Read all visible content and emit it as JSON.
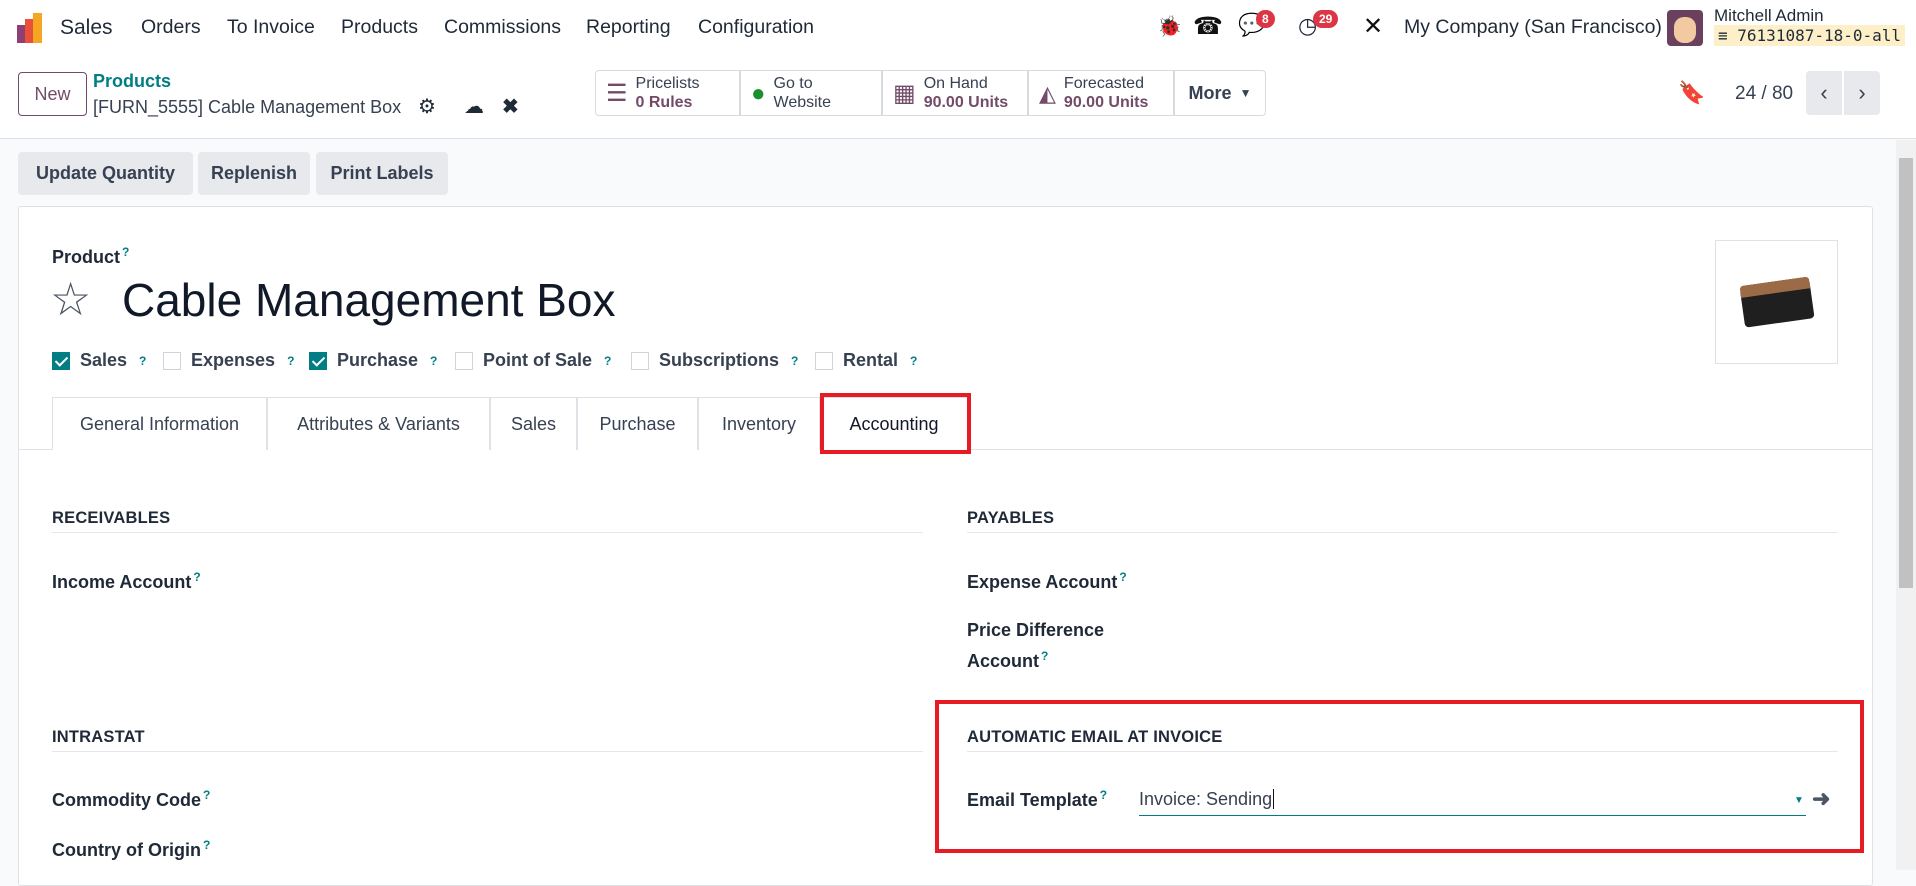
{
  "nav": {
    "app": "Sales",
    "menu": [
      "Orders",
      "To Invoice",
      "Products",
      "Commissions",
      "Reporting",
      "Configuration"
    ],
    "messages_count": "8",
    "activities_count": "29",
    "company": "My Company (San Francisco)",
    "user": "Mitchell Admin",
    "db": "76131087-18-0-all"
  },
  "control": {
    "new_label": "New",
    "breadcrumb_parent": "Products",
    "record_name": "[FURN_5555] Cable Management Box",
    "pager": "24 / 80",
    "more_label": "More",
    "stats": [
      {
        "line1": "Pricelists",
        "line2": "0 Rules"
      },
      {
        "line1": "Go to",
        "line2": "Website"
      },
      {
        "line1": "On Hand",
        "line2": "90.00 Units"
      },
      {
        "line1": "Forecasted",
        "line2": "90.00 Units"
      }
    ]
  },
  "actions": [
    "Update Quantity",
    "Replenish",
    "Print Labels"
  ],
  "form": {
    "product_label": "Product",
    "help": "?",
    "name": "Cable Management Box",
    "options": [
      {
        "label": "Sales",
        "checked": true
      },
      {
        "label": "Expenses",
        "checked": false
      },
      {
        "label": "Purchase",
        "checked": true
      },
      {
        "label": "Point of Sale",
        "checked": false
      },
      {
        "label": "Subscriptions",
        "checked": false
      },
      {
        "label": "Rental",
        "checked": false
      }
    ],
    "tabs": [
      "General Information",
      "Attributes & Variants",
      "Sales",
      "Purchase",
      "Inventory",
      "Accounting"
    ],
    "active_tab": "Accounting",
    "receivables": {
      "title": "RECEIVABLES",
      "income": "Income Account"
    },
    "payables": {
      "title": "PAYABLES",
      "expense": "Expense Account",
      "price_diff_1": "Price Difference",
      "price_diff_2": "Account"
    },
    "intrastat": {
      "title": "INTRASTAT",
      "commodity": "Commodity Code",
      "origin": "Country of Origin"
    },
    "auto_email": {
      "title": "AUTOMATIC EMAIL AT INVOICE",
      "label": "Email Template",
      "value": "Invoice: Sending"
    }
  },
  "colors": {
    "accent": "#017e84",
    "brand": "#714b67",
    "highlight": "#e61b23"
  }
}
